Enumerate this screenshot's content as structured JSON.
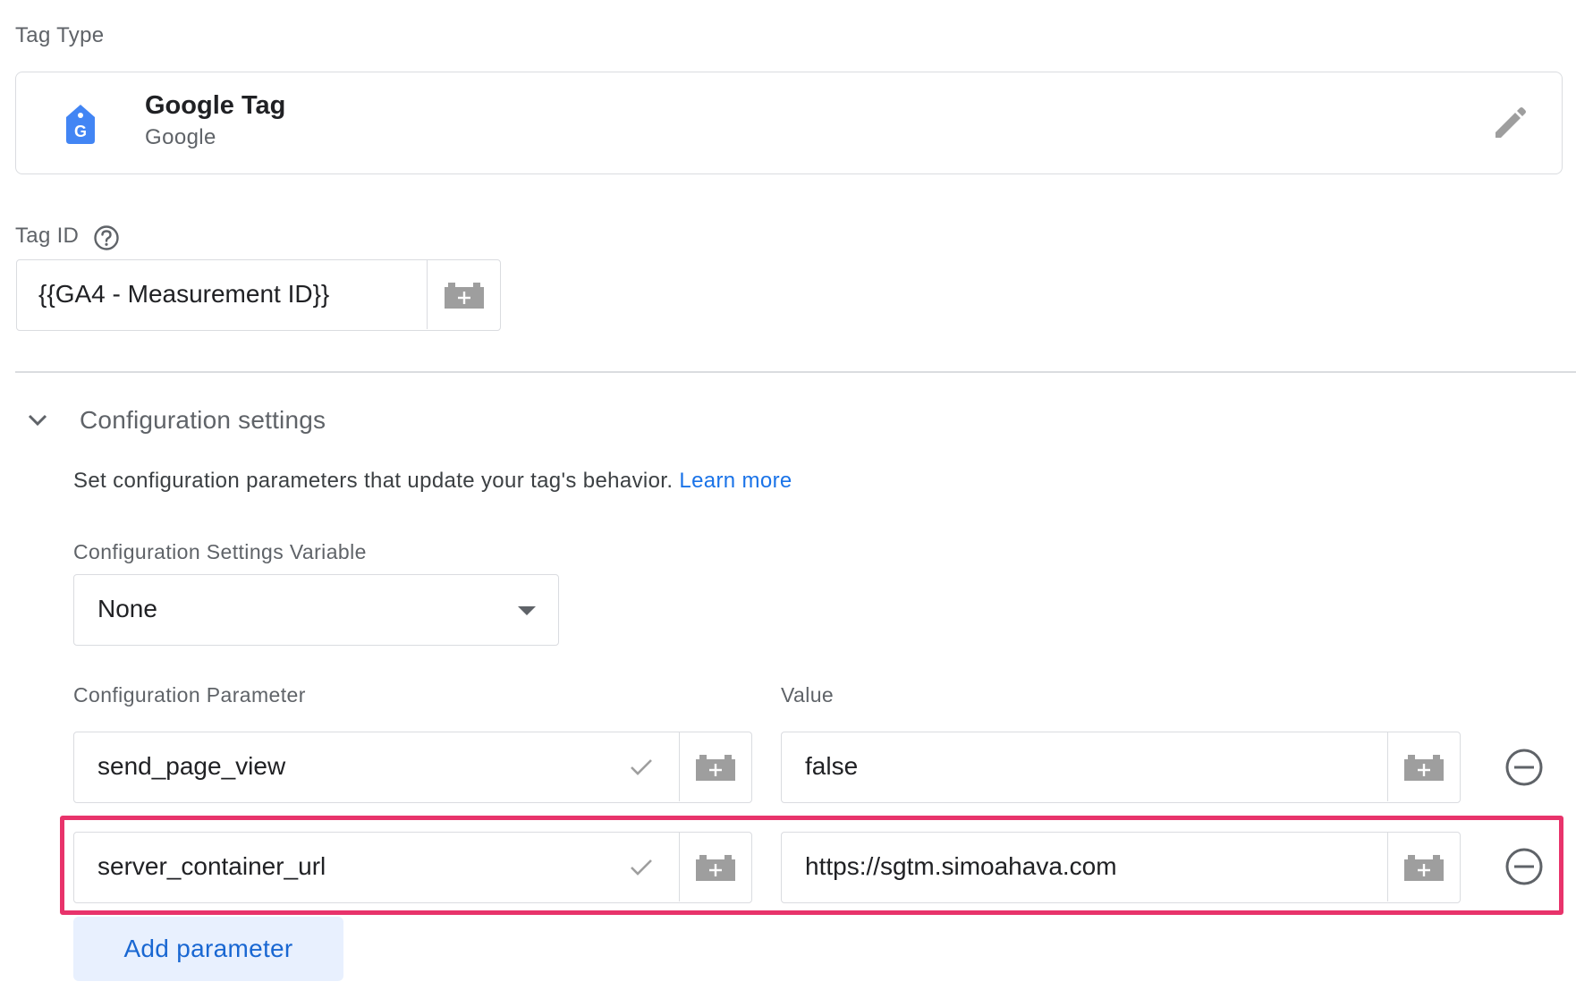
{
  "tag_type": {
    "section_label": "Tag Type",
    "name": "Google Tag",
    "vendor": "Google",
    "icon": "google-tag-icon",
    "edit_icon": "pencil-icon"
  },
  "tag_id": {
    "label": "Tag ID",
    "help_icon": "help-circle-icon",
    "value": "{{GA4 - Measurement ID}}",
    "variable_icon": "variable-picker-icon"
  },
  "config": {
    "title": "Configuration settings",
    "description": "Set configuration parameters that update your tag's behavior.",
    "learn_more": "Learn more",
    "settings_variable": {
      "label": "Configuration Settings Variable",
      "selected": "None"
    },
    "columns": {
      "parameter": "Configuration Parameter",
      "value": "Value"
    },
    "rows": [
      {
        "parameter": "send_page_view",
        "value": "false",
        "highlighted": false
      },
      {
        "parameter": "server_container_url",
        "value": "https://sgtm.simoahava.com",
        "highlighted": true
      }
    ],
    "add_button": "Add parameter"
  },
  "colors": {
    "accent": "#1a73e8",
    "highlight": "#e8336b",
    "button_bg": "#e8f0fe",
    "icon_gray": "#9e9e9e"
  }
}
